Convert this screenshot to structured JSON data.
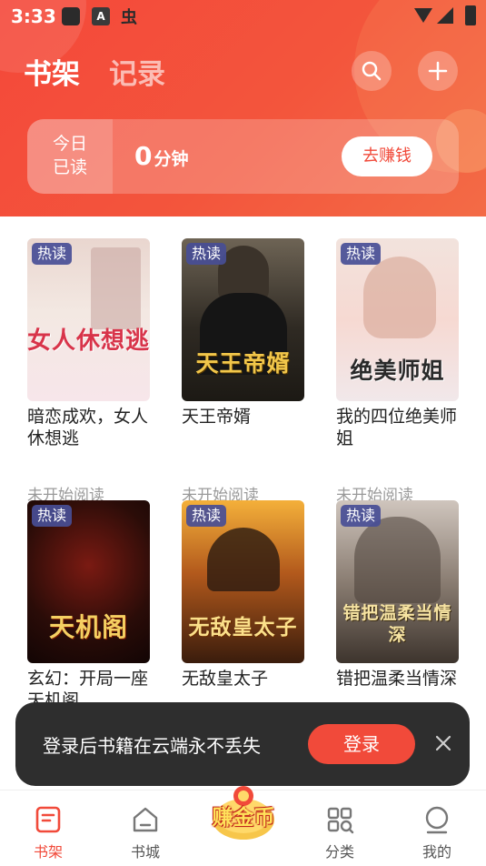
{
  "status_bar": {
    "time": "3:33",
    "app_icon_letter": "A",
    "bug_glyph": "虫"
  },
  "header": {
    "tabs": [
      {
        "label": "书架",
        "active": true
      },
      {
        "label": "记录",
        "active": false
      }
    ],
    "search_icon": "search-icon",
    "add_icon": "plus-icon"
  },
  "reading_card": {
    "today_label_line1": "今日",
    "today_label_line2": "已读",
    "minutes": "0",
    "unit": "分钟",
    "earn_button": "去赚钱"
  },
  "books": [
    {
      "badge": "热读",
      "cover_text": "女人休想逃",
      "title": "暗恋成欢，女人休想逃",
      "status": "未开始阅读"
    },
    {
      "badge": "热读",
      "cover_text": "天王帝婿",
      "title": "天王帝婿",
      "status": "未开始阅读"
    },
    {
      "badge": "热读",
      "cover_text": "绝美师姐",
      "title": "我的四位绝美师姐",
      "status": "未开始阅读"
    },
    {
      "badge": "热读",
      "cover_text": "天机阁",
      "title": "玄幻：开局一座天机阁",
      "status": ""
    },
    {
      "badge": "热读",
      "cover_text": "无敌皇太子",
      "title": "无敌皇太子",
      "status": ""
    },
    {
      "badge": "热读",
      "cover_text": "错把温柔当情深",
      "title": "错把温柔当情深",
      "status": ""
    }
  ],
  "toast": {
    "message": "登录后书籍在云端永不丢失",
    "login_button": "登录"
  },
  "tabbar": {
    "items": [
      {
        "label": "书架",
        "active": true
      },
      {
        "label": "书城",
        "active": false
      },
      {
        "label": "赚金币",
        "active": false
      },
      {
        "label": "分类",
        "active": false
      },
      {
        "label": "我的",
        "active": false
      }
    ]
  },
  "colors": {
    "accent": "#f14a3a",
    "header_gradient_start": "#f4483a",
    "header_gradient_end": "#f36b46",
    "badge": "#484e96"
  }
}
